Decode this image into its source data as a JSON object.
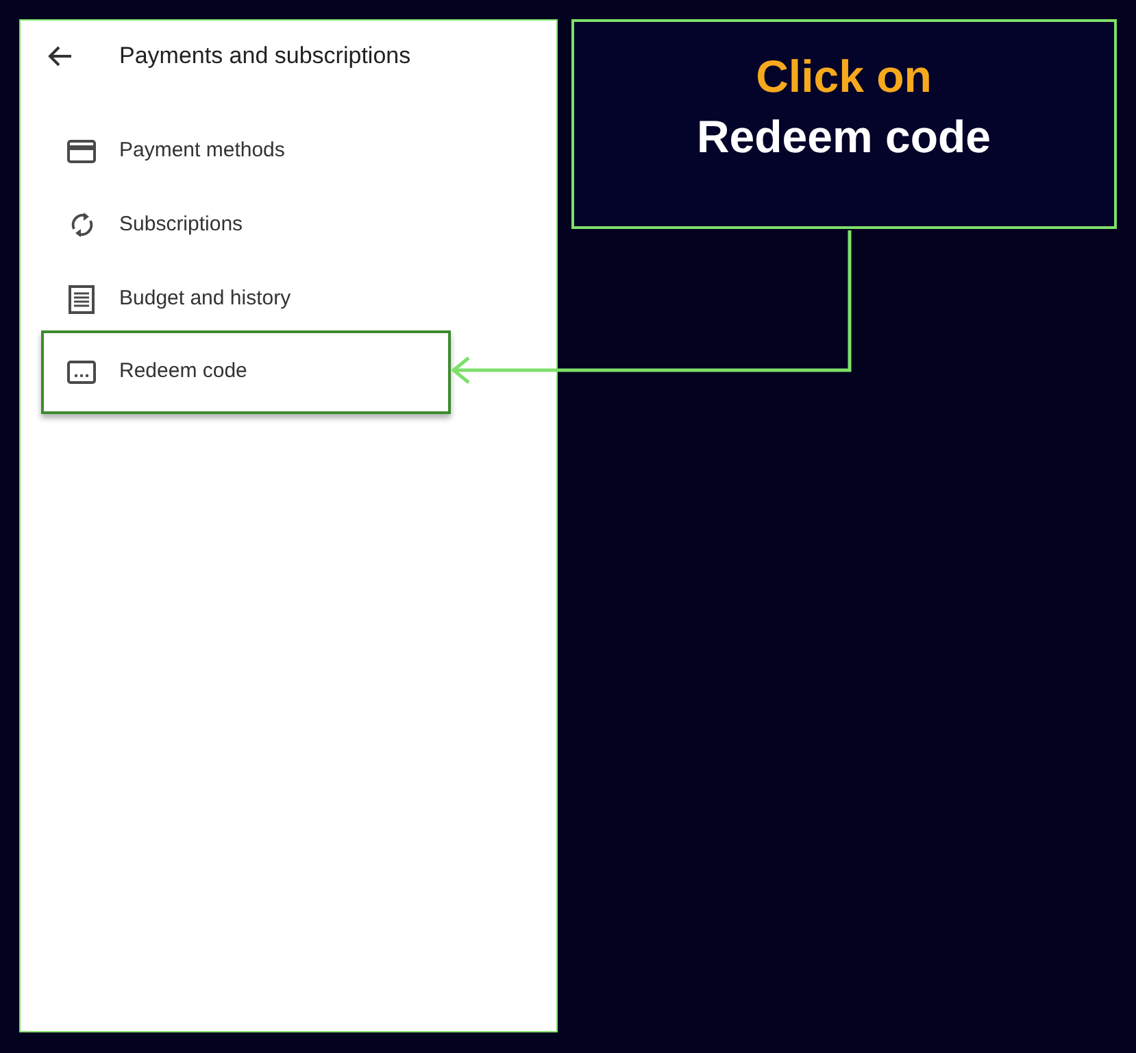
{
  "screen": {
    "title": "Payments and subscriptions",
    "items": [
      {
        "label": "Payment methods",
        "kind": "card",
        "selected": false
      },
      {
        "label": "Subscriptions",
        "kind": "renew",
        "selected": false
      },
      {
        "label": "Budget and history",
        "kind": "receipt",
        "selected": false
      },
      {
        "label": "Redeem code",
        "kind": "code",
        "selected": true
      }
    ]
  },
  "callout": {
    "lines": [
      {
        "text": "Click on",
        "kind": "accent"
      },
      {
        "text": "Redeem code",
        "kind": "plain"
      }
    ]
  }
}
